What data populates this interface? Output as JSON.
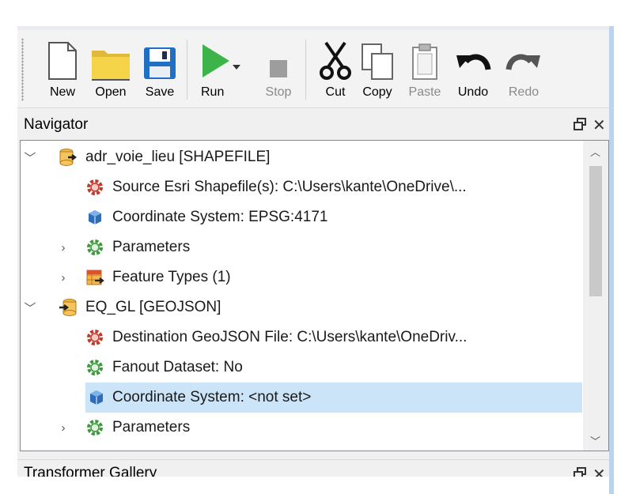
{
  "toolbar": {
    "buttons": [
      {
        "label": "New",
        "icon": "new-document-icon",
        "enabled": true
      },
      {
        "label": "Open",
        "icon": "open-folder-icon",
        "enabled": true
      },
      {
        "label": "Save",
        "icon": "save-disk-icon",
        "enabled": true
      },
      {
        "label": "Run",
        "icon": "run-play-icon",
        "enabled": true
      },
      {
        "label": "Stop",
        "icon": "stop-square-icon",
        "enabled": false
      },
      {
        "label": "Cut",
        "icon": "scissors-icon",
        "enabled": true
      },
      {
        "label": "Copy",
        "icon": "copy-icon",
        "enabled": true
      },
      {
        "label": "Paste",
        "icon": "clipboard-paste-icon",
        "enabled": false
      },
      {
        "label": "Undo",
        "icon": "undo-arrow-icon",
        "enabled": true
      },
      {
        "label": "Redo",
        "icon": "redo-arrow-icon",
        "enabled": false
      }
    ]
  },
  "navigator": {
    "title": "Navigator",
    "items": [
      {
        "label": "adr_voie_lieu [SHAPEFILE]",
        "icon": "reader-dataset-icon",
        "expanded": true
      },
      {
        "label": "Source Esri Shapefile(s): C:\\Users\\kante\\OneDrive\\...",
        "icon": "red-gear-icon"
      },
      {
        "label": "Coordinate System: EPSG:4171",
        "icon": "coordinate-system-icon"
      },
      {
        "label": "Parameters",
        "icon": "green-gear-icon",
        "expanded": false
      },
      {
        "label": "Feature Types (1)",
        "icon": "feature-types-icon",
        "expanded": false
      },
      {
        "label": "EQ_GL [GEOJSON]",
        "icon": "writer-dataset-icon",
        "expanded": true
      },
      {
        "label": "Destination GeoJSON File: C:\\Users\\kante\\OneDriv...",
        "icon": "red-gear-icon"
      },
      {
        "label": "Fanout Dataset: No",
        "icon": "green-gear-icon"
      },
      {
        "label": "Coordinate System: <not set>",
        "icon": "coordinate-system-icon",
        "selected": true
      },
      {
        "label": "Parameters",
        "icon": "green-gear-icon",
        "expanded": false
      }
    ]
  },
  "transformer_gallery": {
    "title": "Transformer Gallery"
  },
  "colors": {
    "selection": "#cce4f7",
    "run_green": "#3cb44a",
    "folder_yellow": "#f6d44a",
    "save_blue": "#1f6fc5"
  }
}
